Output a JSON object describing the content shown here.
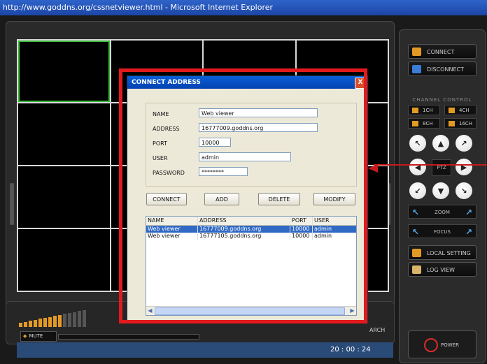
{
  "window": {
    "title": "http://www.goddns.org/cssnetviewer.html - Microsoft Internet Explorer"
  },
  "panel": {
    "connect_label": "CONNECT",
    "disconnect_label": "DISCONNECT",
    "channel_control_title": "CHANNEL CONTROL",
    "channel_buttons": [
      "1CH",
      "4CH",
      "8CH",
      "16CH"
    ],
    "ptz_label": "PTZ",
    "zoom_label": "ZOOM",
    "focus_label": "FOCUS",
    "local_setting_label": "LOCAL SETTING",
    "log_view_label": "LOG VIEW",
    "power_label": "POWER"
  },
  "audio": {
    "mute_label": "MUTE",
    "level_bars_on": 9,
    "level_bars_total": 14
  },
  "bottom": {
    "arch_label": "ARCH"
  },
  "status": {
    "time": "20 : 00 : 24"
  },
  "dialog": {
    "title": "CONNECT ADDRESS",
    "close_glyph": "X",
    "labels": {
      "name": "NAME",
      "address": "ADDRESS",
      "port": "PORT",
      "user": "USER",
      "password": "PASSWORD"
    },
    "values": {
      "name": "Web viewer",
      "address": "16777009.goddns.org",
      "port": "10000",
      "user": "admin",
      "password": "********"
    },
    "buttons": {
      "connect": "CONNECT",
      "add": "ADD",
      "delete": "DELETE",
      "modify": "MODIFY"
    },
    "list": {
      "headers": [
        "NAME",
        "ADDRESS",
        "PORT",
        "USER"
      ],
      "rows": [
        [
          "Web viewer",
          "16777009.goddns.org",
          "10000",
          "admin"
        ],
        [
          "Web viewer",
          "16777105.goddns.org",
          "10000",
          "admin"
        ]
      ],
      "selected_row": 0
    }
  },
  "colors": {
    "annotation_red": "#e4191c",
    "accent_orange": "#e39a24",
    "selection_green": "#3db83d",
    "xp_title_blue": "#0a5fd8"
  }
}
